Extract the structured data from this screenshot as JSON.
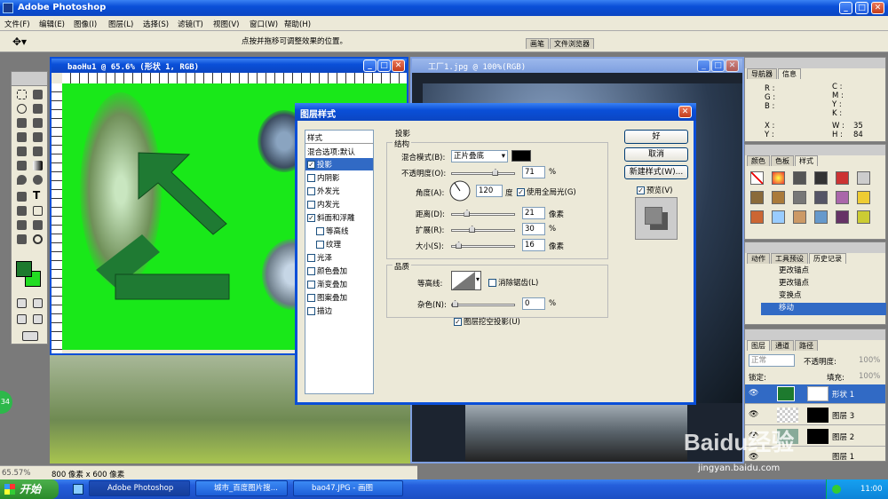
{
  "app": {
    "title": "Adobe Photoshop"
  },
  "menu": [
    "文件(F)",
    "编辑(E)",
    "图像(I)",
    "图层(L)",
    "选择(S)",
    "滤镜(T)",
    "视图(V)",
    "窗口(W)",
    "帮助(H)"
  ],
  "options_bar": {
    "hint": "点按并拖移可调整效果的位置。",
    "tab_brushes": "画笔",
    "tab_file_browser": "文件浏览器"
  },
  "doc1": {
    "title": "baoHu1 @ 65.6% (形状 1, RGB)",
    "zoom": "65.57%",
    "size": "800 像素 x 600 像素"
  },
  "doc2": {
    "title": "工厂1.jpg @ 100%(RGB)"
  },
  "navigator": {
    "tab1": "导航器",
    "tab2": "信息",
    "r": "R :",
    "g": "G :",
    "b": "B :",
    "c": "C :",
    "m": "M :",
    "y": "Y :",
    "k": "K :",
    "x": "X :",
    "y2": "Y :",
    "w": "W :",
    "h": "H :",
    "w_val": "35",
    "h_val": "84"
  },
  "swatches_panel": {
    "tab1": "颜色",
    "tab2": "色板",
    "tab3": "样式"
  },
  "history_panel": {
    "tabs": [
      "动作",
      "工具预设",
      "历史记录"
    ],
    "items": [
      "更改锚点",
      "更改锚点",
      "变换点",
      "移动"
    ]
  },
  "layers_panel": {
    "tabs": [
      "图层",
      "通道",
      "路径"
    ],
    "blend": "正常",
    "opacity_label": "不透明度:",
    "opacity": "100%",
    "lock": "锁定:",
    "fill_label": "填充:",
    "fill": "100%",
    "layers": [
      "形状 1",
      "图层 3",
      "图层 2",
      "图层 1"
    ]
  },
  "dialog": {
    "title": "图层样式",
    "styles_header": "样式",
    "styles": [
      "混合选项:默认",
      "投影",
      "内阴影",
      "外发光",
      "内发光",
      "斜面和浮雕",
      "等高线",
      "纹理",
      "光泽",
      "颜色叠加",
      "渐变叠加",
      "图案叠加",
      "描边"
    ],
    "section_title": "投影",
    "structure_title": "结构",
    "blend_mode_label": "混合模式(B):",
    "blend_mode": "正片叠底",
    "opacity_label": "不透明度(O):",
    "opacity": "71",
    "pct": "%",
    "angle_label": "角度(A):",
    "angle": "120",
    "degree": "度",
    "global_light": "使用全局光(G)",
    "distance_label": "距离(D):",
    "distance": "21",
    "spread_label": "扩展(R):",
    "spread": "30",
    "size_label": "大小(S):",
    "size": "16",
    "px": "像素",
    "quality_title": "品质",
    "contour_label": "等高线:",
    "antialias": "消除锯齿(L)",
    "noise_label": "杂色(N):",
    "noise": "0",
    "knockout": "图层挖空投影(U)",
    "ok": "好",
    "cancel": "取消",
    "new_style": "新建样式(W)...",
    "preview": "预览(V)",
    "values": {
      "opacity": 0.71,
      "distance": 0.21,
      "spread": 0.3,
      "size": 0.064,
      "noise": 0.0
    }
  },
  "taskbar": {
    "start": "开始",
    "items": [
      "Adobe Photoshop",
      "城市_百度图片搜...",
      "bao47.JPG - 画图"
    ],
    "clock": "11:00"
  },
  "watermark": {
    "text": "Baidu经验",
    "url": "jingyan.baidu.com"
  },
  "badge": "34"
}
